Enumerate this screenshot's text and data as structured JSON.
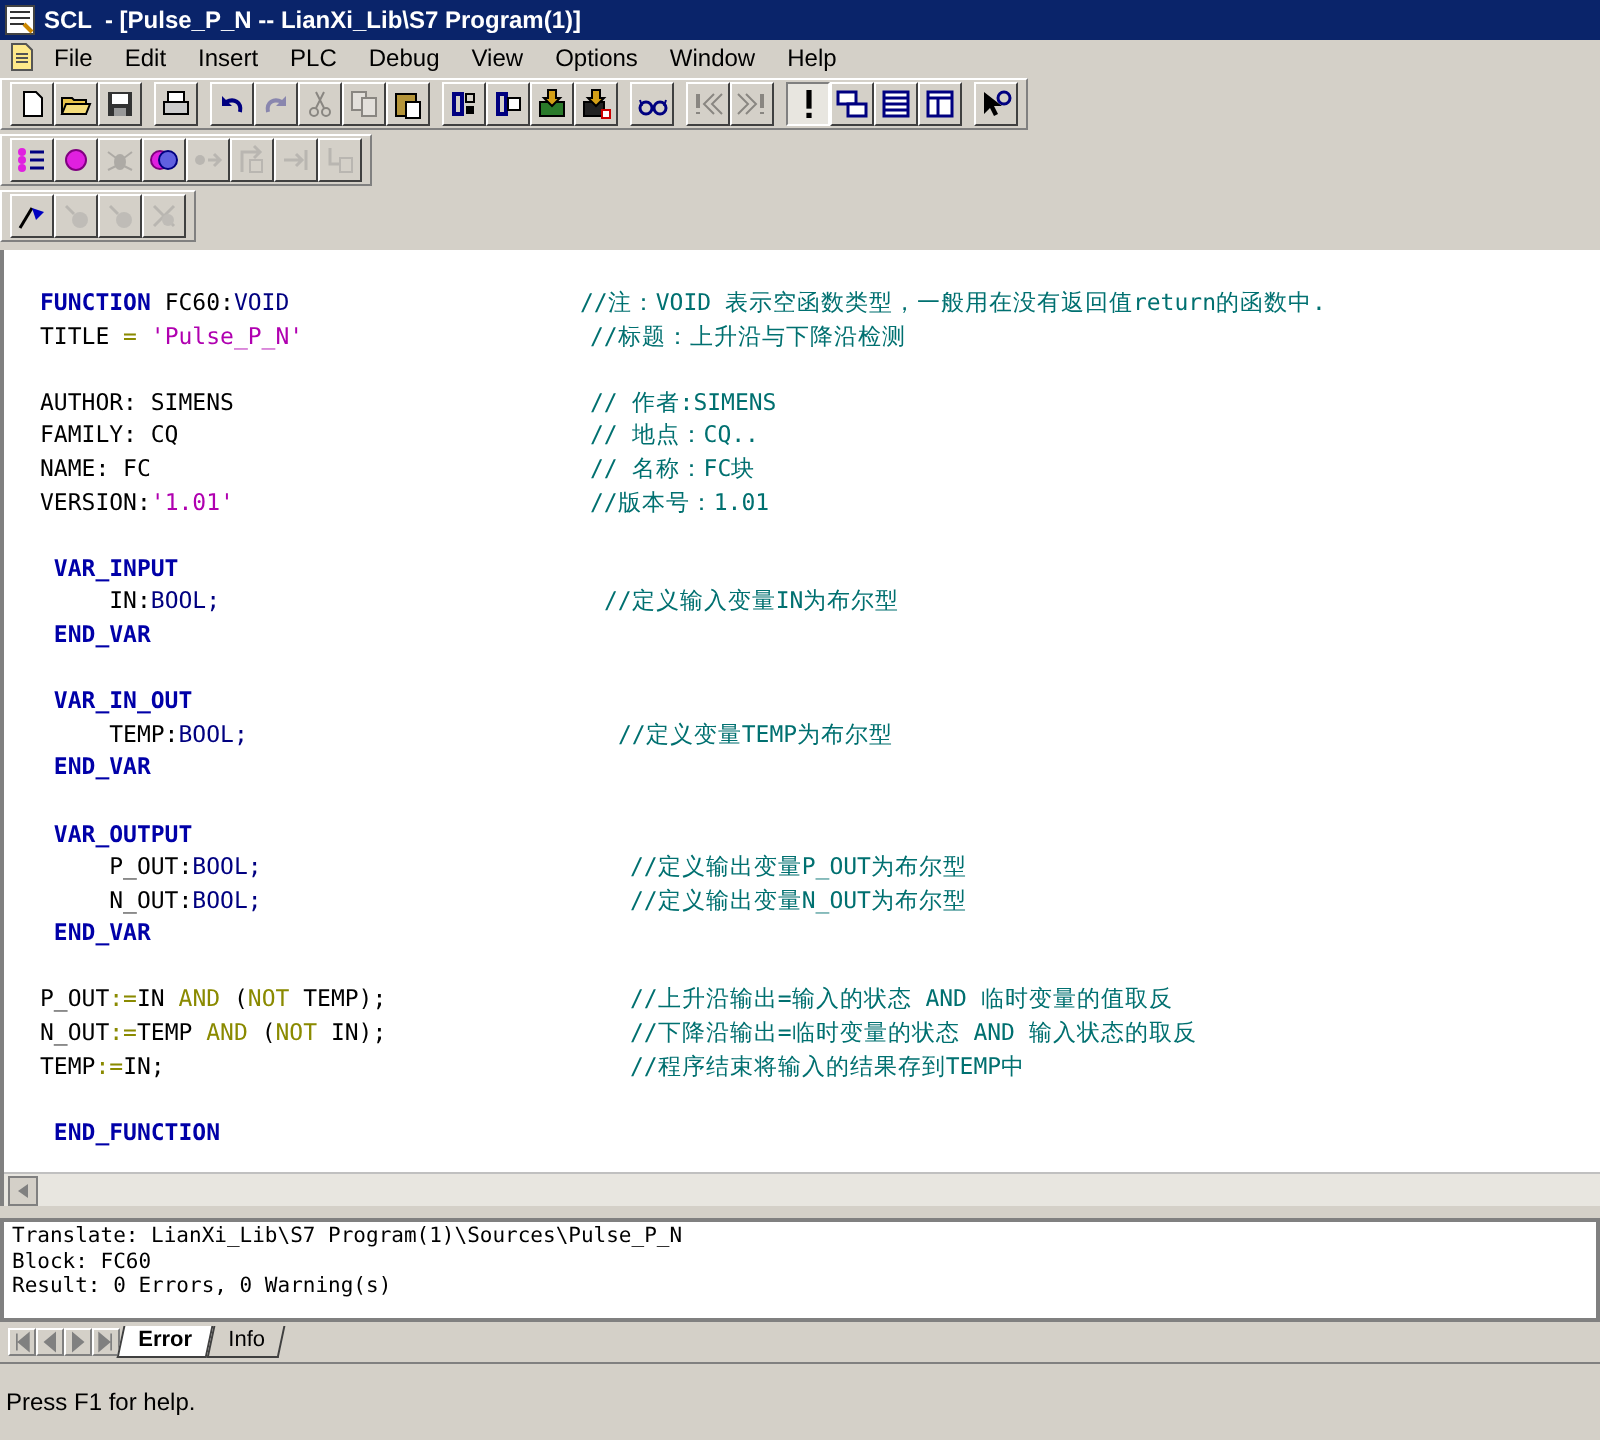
{
  "window": {
    "title": "SCL  - [Pulse_P_N -- LianXi_Lib\\S7 Program(1)]"
  },
  "menu": [
    "File",
    "Edit",
    "Insert",
    "PLC",
    "Debug",
    "View",
    "Options",
    "Window",
    "Help"
  ],
  "toolbars": [
    {
      "groups": [
        [
          {
            "disabled": false
          },
          {
            "disabled": false
          },
          {
            "disabled": false
          }
        ],
        [
          {
            "disabled": false
          }
        ],
        [
          {
            "disabled": false
          },
          {
            "disabled": true
          },
          {
            "disabled": true
          },
          {
            "disabled": true
          },
          {
            "disabled": false
          }
        ],
        [
          {
            "disabled": false
          },
          {
            "disabled": false
          },
          {
            "disabled": false
          },
          {
            "disabled": false
          }
        ],
        [
          {
            "disabled": false
          }
        ],
        [
          {
            "disabled": true
          },
          {
            "disabled": true
          }
        ],
        [
          {
            "disabled": false,
            "pressed": true
          },
          {
            "disabled": false,
            "pressed": false
          },
          {
            "disabled": false,
            "pressed": false
          },
          {
            "disabled": false,
            "pressed": false
          }
        ],
        [
          {
            "disabled": false
          }
        ]
      ]
    },
    {
      "groups": [
        [
          {
            "disabled": false
          },
          {
            "disabled": false
          },
          {
            "disabled": true
          },
          {
            "disabled": false
          },
          {
            "disabled": true
          },
          {
            "disabled": true
          },
          {
            "disabled": true
          },
          {
            "disabled": true
          }
        ]
      ]
    },
    {
      "groups": [
        [
          {
            "disabled": false
          },
          {
            "disabled": true
          },
          {
            "disabled": true
          },
          {
            "disabled": true
          }
        ]
      ]
    }
  ],
  "code": [
    {
      "tokens": [
        {
          "kind": "keyword",
          "text": "FUNCTION"
        },
        {
          "kind": "plain",
          "text": " FC60:"
        },
        {
          "kind": "type",
          "text": "VOID"
        }
      ],
      "comment": "//注：VOID 表示空函数类型，一般用在没有返回值return的函数中."
    },
    {
      "tokens": [
        {
          "kind": "plain",
          "text": "TITLE "
        },
        {
          "kind": "operator",
          "text": "="
        },
        {
          "kind": "string",
          "text": " 'Pulse_P_N'"
        }
      ],
      "comment": "//标题：上升沿与下降沿检测"
    },
    {
      "space_before": true,
      "tokens": [
        {
          "kind": "plain",
          "text": "AUTHOR: SIMENS"
        }
      ],
      "comment": "// 作者:SIMENS"
    },
    {
      "tokens": [
        {
          "kind": "plain",
          "text": "FAMILY: CQ"
        }
      ],
      "comment": "// 地点：CQ.."
    },
    {
      "tokens": [
        {
          "kind": "plain",
          "text": "NAME: FC"
        }
      ],
      "comment": "// 名称：FC块"
    },
    {
      "tokens": [
        {
          "kind": "plain",
          "text": "VERSION:"
        },
        {
          "kind": "string",
          "text": "'1.01'"
        }
      ],
      "comment": "//版本号：1.01"
    },
    {
      "space_before": true,
      "tokens": [
        {
          "kind": "keyword",
          "text": " VAR_INPUT"
        }
      ]
    },
    {
      "tokens": [
        {
          "kind": "plain",
          "text": "     IN:"
        },
        {
          "kind": "type",
          "text": "BOOL;"
        }
      ],
      "comment": "//定义输入变量IN为布尔型"
    },
    {
      "tokens": [
        {
          "kind": "keyword",
          "text": " END_VAR"
        }
      ]
    },
    {
      "space_before": true,
      "tokens": [
        {
          "kind": "keyword",
          "text": " VAR_IN_OUT"
        }
      ]
    },
    {
      "tokens": [
        {
          "kind": "plain",
          "text": "     TEMP:"
        },
        {
          "kind": "type",
          "text": "BOOL;"
        }
      ],
      "comment": "//定义变量TEMP为布尔型"
    },
    {
      "tokens": [
        {
          "kind": "keyword",
          "text": " END_VAR"
        }
      ]
    },
    {
      "space_before": true,
      "tokens": [
        {
          "kind": "keyword",
          "text": " VAR_OUTPUT"
        }
      ]
    },
    {
      "tokens": [
        {
          "kind": "plain",
          "text": "     P_OUT:"
        },
        {
          "kind": "type",
          "text": "BOOL;"
        }
      ],
      "comment": "//定义输出变量P_OUT为布尔型"
    },
    {
      "tokens": [
        {
          "kind": "plain",
          "text": "     N_OUT:"
        },
        {
          "kind": "type",
          "text": "BOOL;"
        }
      ],
      "comment": "//定义输出变量N_OUT为布尔型"
    },
    {
      "tokens": [
        {
          "kind": "keyword",
          "text": " END_VAR"
        }
      ]
    },
    {
      "space_before": true,
      "tokens": [
        {
          "kind": "plain",
          "text": "P_OUT"
        },
        {
          "kind": "operator",
          "text": ":="
        },
        {
          "kind": "plain",
          "text": "IN "
        },
        {
          "kind": "operator",
          "text": "AND"
        },
        {
          "kind": "plain",
          "text": " ("
        },
        {
          "kind": "operator",
          "text": "NOT"
        },
        {
          "kind": "plain",
          "text": " TEMP);"
        }
      ],
      "comment": "//上升沿输出=输入的状态 AND 临时变量的值取反"
    },
    {
      "tokens": [
        {
          "kind": "plain",
          "text": "N_OUT"
        },
        {
          "kind": "operator",
          "text": ":="
        },
        {
          "kind": "plain",
          "text": "TEMP "
        },
        {
          "kind": "operator",
          "text": "AND"
        },
        {
          "kind": "plain",
          "text": " ("
        },
        {
          "kind": "operator",
          "text": "NOT"
        },
        {
          "kind": "plain",
          "text": " IN);"
        }
      ],
      "comment": "//下降沿输出=临时变量的状态 AND 输入状态的取反"
    },
    {
      "tokens": [
        {
          "kind": "plain",
          "text": "TEMP"
        },
        {
          "kind": "operator",
          "text": ":="
        },
        {
          "kind": "plain",
          "text": "IN;"
        }
      ],
      "comment": "//程序结束将输入的结果存到TEMP中"
    },
    {
      "space_before": true,
      "tokens": [
        {
          "kind": "keyword",
          "text": " END_FUNCTION"
        }
      ]
    }
  ],
  "output": [
    "Translate: LianXi_Lib\\S7 Program(1)\\Sources\\Pulse_P_N",
    "Block: FC60",
    "Result: 0 Errors, 0 Warning(s)"
  ],
  "output_tabs": [
    {
      "label": "Error",
      "selected": true
    },
    {
      "label": "Info",
      "selected": false
    }
  ],
  "status_bar": "Press F1 for help."
}
